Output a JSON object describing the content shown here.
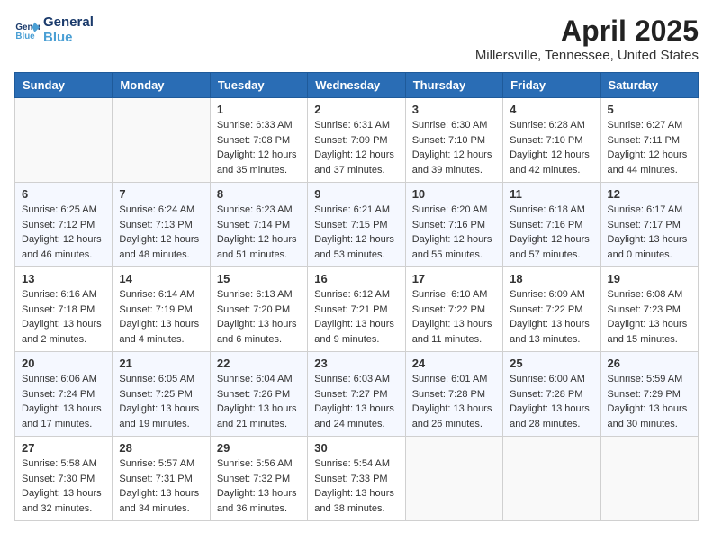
{
  "header": {
    "logo_line1": "General",
    "logo_line2": "Blue",
    "month": "April 2025",
    "location": "Millersville, Tennessee, United States"
  },
  "weekdays": [
    "Sunday",
    "Monday",
    "Tuesday",
    "Wednesday",
    "Thursday",
    "Friday",
    "Saturday"
  ],
  "weeks": [
    [
      {
        "day": "",
        "sunrise": "",
        "sunset": "",
        "daylight": ""
      },
      {
        "day": "",
        "sunrise": "",
        "sunset": "",
        "daylight": ""
      },
      {
        "day": "1",
        "sunrise": "Sunrise: 6:33 AM",
        "sunset": "Sunset: 7:08 PM",
        "daylight": "Daylight: 12 hours and 35 minutes."
      },
      {
        "day": "2",
        "sunrise": "Sunrise: 6:31 AM",
        "sunset": "Sunset: 7:09 PM",
        "daylight": "Daylight: 12 hours and 37 minutes."
      },
      {
        "day": "3",
        "sunrise": "Sunrise: 6:30 AM",
        "sunset": "Sunset: 7:10 PM",
        "daylight": "Daylight: 12 hours and 39 minutes."
      },
      {
        "day": "4",
        "sunrise": "Sunrise: 6:28 AM",
        "sunset": "Sunset: 7:10 PM",
        "daylight": "Daylight: 12 hours and 42 minutes."
      },
      {
        "day": "5",
        "sunrise": "Sunrise: 6:27 AM",
        "sunset": "Sunset: 7:11 PM",
        "daylight": "Daylight: 12 hours and 44 minutes."
      }
    ],
    [
      {
        "day": "6",
        "sunrise": "Sunrise: 6:25 AM",
        "sunset": "Sunset: 7:12 PM",
        "daylight": "Daylight: 12 hours and 46 minutes."
      },
      {
        "day": "7",
        "sunrise": "Sunrise: 6:24 AM",
        "sunset": "Sunset: 7:13 PM",
        "daylight": "Daylight: 12 hours and 48 minutes."
      },
      {
        "day": "8",
        "sunrise": "Sunrise: 6:23 AM",
        "sunset": "Sunset: 7:14 PM",
        "daylight": "Daylight: 12 hours and 51 minutes."
      },
      {
        "day": "9",
        "sunrise": "Sunrise: 6:21 AM",
        "sunset": "Sunset: 7:15 PM",
        "daylight": "Daylight: 12 hours and 53 minutes."
      },
      {
        "day": "10",
        "sunrise": "Sunrise: 6:20 AM",
        "sunset": "Sunset: 7:16 PM",
        "daylight": "Daylight: 12 hours and 55 minutes."
      },
      {
        "day": "11",
        "sunrise": "Sunrise: 6:18 AM",
        "sunset": "Sunset: 7:16 PM",
        "daylight": "Daylight: 12 hours and 57 minutes."
      },
      {
        "day": "12",
        "sunrise": "Sunrise: 6:17 AM",
        "sunset": "Sunset: 7:17 PM",
        "daylight": "Daylight: 13 hours and 0 minutes."
      }
    ],
    [
      {
        "day": "13",
        "sunrise": "Sunrise: 6:16 AM",
        "sunset": "Sunset: 7:18 PM",
        "daylight": "Daylight: 13 hours and 2 minutes."
      },
      {
        "day": "14",
        "sunrise": "Sunrise: 6:14 AM",
        "sunset": "Sunset: 7:19 PM",
        "daylight": "Daylight: 13 hours and 4 minutes."
      },
      {
        "day": "15",
        "sunrise": "Sunrise: 6:13 AM",
        "sunset": "Sunset: 7:20 PM",
        "daylight": "Daylight: 13 hours and 6 minutes."
      },
      {
        "day": "16",
        "sunrise": "Sunrise: 6:12 AM",
        "sunset": "Sunset: 7:21 PM",
        "daylight": "Daylight: 13 hours and 9 minutes."
      },
      {
        "day": "17",
        "sunrise": "Sunrise: 6:10 AM",
        "sunset": "Sunset: 7:22 PM",
        "daylight": "Daylight: 13 hours and 11 minutes."
      },
      {
        "day": "18",
        "sunrise": "Sunrise: 6:09 AM",
        "sunset": "Sunset: 7:22 PM",
        "daylight": "Daylight: 13 hours and 13 minutes."
      },
      {
        "day": "19",
        "sunrise": "Sunrise: 6:08 AM",
        "sunset": "Sunset: 7:23 PM",
        "daylight": "Daylight: 13 hours and 15 minutes."
      }
    ],
    [
      {
        "day": "20",
        "sunrise": "Sunrise: 6:06 AM",
        "sunset": "Sunset: 7:24 PM",
        "daylight": "Daylight: 13 hours and 17 minutes."
      },
      {
        "day": "21",
        "sunrise": "Sunrise: 6:05 AM",
        "sunset": "Sunset: 7:25 PM",
        "daylight": "Daylight: 13 hours and 19 minutes."
      },
      {
        "day": "22",
        "sunrise": "Sunrise: 6:04 AM",
        "sunset": "Sunset: 7:26 PM",
        "daylight": "Daylight: 13 hours and 21 minutes."
      },
      {
        "day": "23",
        "sunrise": "Sunrise: 6:03 AM",
        "sunset": "Sunset: 7:27 PM",
        "daylight": "Daylight: 13 hours and 24 minutes."
      },
      {
        "day": "24",
        "sunrise": "Sunrise: 6:01 AM",
        "sunset": "Sunset: 7:28 PM",
        "daylight": "Daylight: 13 hours and 26 minutes."
      },
      {
        "day": "25",
        "sunrise": "Sunrise: 6:00 AM",
        "sunset": "Sunset: 7:28 PM",
        "daylight": "Daylight: 13 hours and 28 minutes."
      },
      {
        "day": "26",
        "sunrise": "Sunrise: 5:59 AM",
        "sunset": "Sunset: 7:29 PM",
        "daylight": "Daylight: 13 hours and 30 minutes."
      }
    ],
    [
      {
        "day": "27",
        "sunrise": "Sunrise: 5:58 AM",
        "sunset": "Sunset: 7:30 PM",
        "daylight": "Daylight: 13 hours and 32 minutes."
      },
      {
        "day": "28",
        "sunrise": "Sunrise: 5:57 AM",
        "sunset": "Sunset: 7:31 PM",
        "daylight": "Daylight: 13 hours and 34 minutes."
      },
      {
        "day": "29",
        "sunrise": "Sunrise: 5:56 AM",
        "sunset": "Sunset: 7:32 PM",
        "daylight": "Daylight: 13 hours and 36 minutes."
      },
      {
        "day": "30",
        "sunrise": "Sunrise: 5:54 AM",
        "sunset": "Sunset: 7:33 PM",
        "daylight": "Daylight: 13 hours and 38 minutes."
      },
      {
        "day": "",
        "sunrise": "",
        "sunset": "",
        "daylight": ""
      },
      {
        "day": "",
        "sunrise": "",
        "sunset": "",
        "daylight": ""
      },
      {
        "day": "",
        "sunrise": "",
        "sunset": "",
        "daylight": ""
      }
    ]
  ]
}
